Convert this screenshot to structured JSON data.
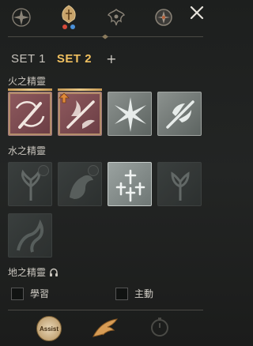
{
  "top_tabs": [
    {
      "name": "compass-star"
    },
    {
      "name": "spirit-set"
    },
    {
      "name": "ornament-crest"
    },
    {
      "name": "round-emblem"
    }
  ],
  "sets": {
    "tab1": "SET 1",
    "tab2": "SET 2",
    "add": "+"
  },
  "sections": {
    "fire": "火之精靈",
    "water": "水之精靈",
    "earth": "地之精靈"
  },
  "options": {
    "learn": "學習",
    "active": "主動"
  },
  "bottom": {
    "assist": "Assist"
  },
  "colors": {
    "active_set": "#f0c060",
    "fire_slot": "#8f5a5e",
    "equip_bar": "#e9c886"
  }
}
